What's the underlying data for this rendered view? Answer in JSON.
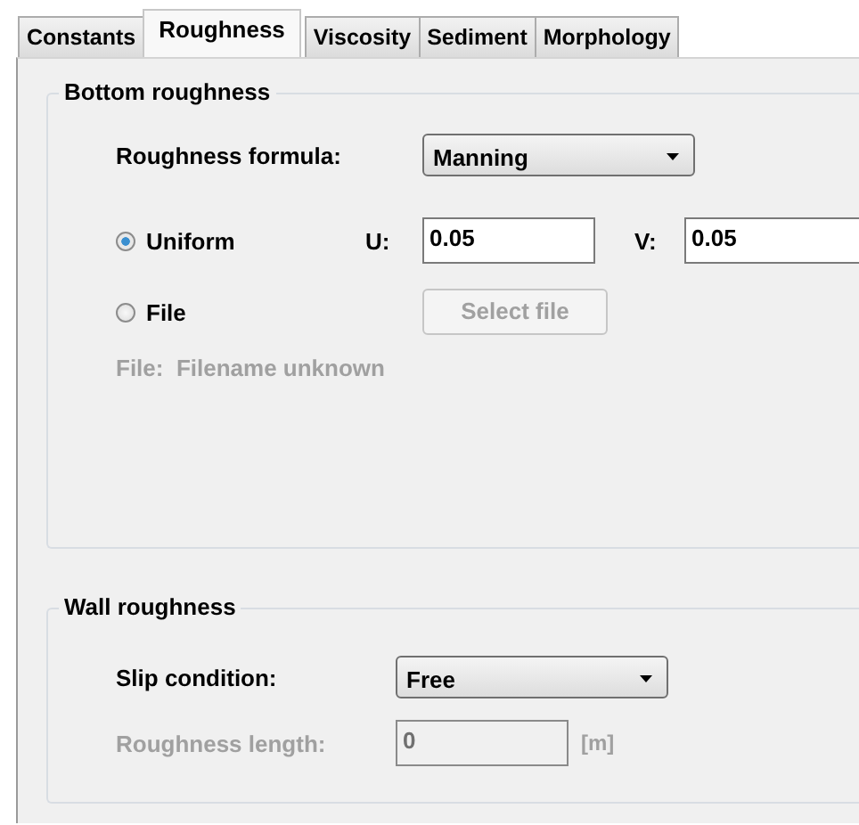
{
  "tabs": [
    {
      "label": "Constants",
      "selected": false
    },
    {
      "label": "Roughness",
      "selected": true
    },
    {
      "label": "Viscosity",
      "selected": false
    },
    {
      "label": "Sediment",
      "selected": false
    },
    {
      "label": "Morphology",
      "selected": false
    }
  ],
  "bottom_roughness": {
    "title": "Bottom roughness",
    "formula": {
      "label": "Roughness formula:",
      "value": "Manning"
    },
    "options": [
      {
        "kind": "uniform",
        "label": "Uniform",
        "selected": true,
        "u_label": "U:",
        "u_value": "0.05",
        "v_label": "V:",
        "v_value": "0.05"
      },
      {
        "kind": "file",
        "label": "File",
        "selected": false,
        "button": {
          "label": "Select file",
          "disabled": true
        }
      }
    ],
    "file_status": {
      "text": "File:  Filename unknown",
      "disabled": true
    }
  },
  "wall_roughness": {
    "title": "Wall roughness",
    "slip": {
      "label": "Slip condition:",
      "value": "Free"
    },
    "length": {
      "label": "Roughness length:",
      "value": "0",
      "unit": "[m]",
      "disabled": true
    }
  }
}
